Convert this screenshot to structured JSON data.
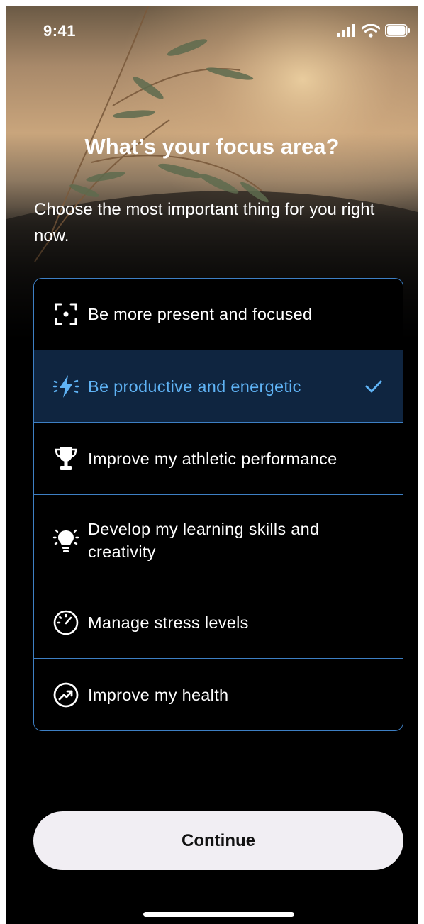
{
  "status_bar": {
    "time": "9:41",
    "icons": [
      "cellular-signal-icon",
      "wifi-icon",
      "battery-icon"
    ]
  },
  "header": {
    "title": "What’s your focus area?",
    "subtitle": "Choose the most important thing for you right now."
  },
  "options": [
    {
      "label": "Be more present and focused",
      "icon": "focus-frame-icon",
      "selected": false
    },
    {
      "label": "Be productive and energetic",
      "icon": "lightning-bolt-icon",
      "selected": true
    },
    {
      "label": "Improve my athletic performance",
      "icon": "trophy-icon",
      "selected": false
    },
    {
      "label": "Develop my learning skills and creativity",
      "icon": "lightbulb-icon",
      "selected": false
    },
    {
      "label": "Manage stress levels",
      "icon": "gauge-icon",
      "selected": false
    },
    {
      "label": "Improve my health",
      "icon": "trending-up-icon",
      "selected": false
    }
  ],
  "colors": {
    "accent": "#5fb3f5",
    "border": "#3d7fc4",
    "selected_bg": "#0f2540",
    "button_bg": "#f1eef3"
  },
  "continue_button": {
    "label": "Continue"
  }
}
